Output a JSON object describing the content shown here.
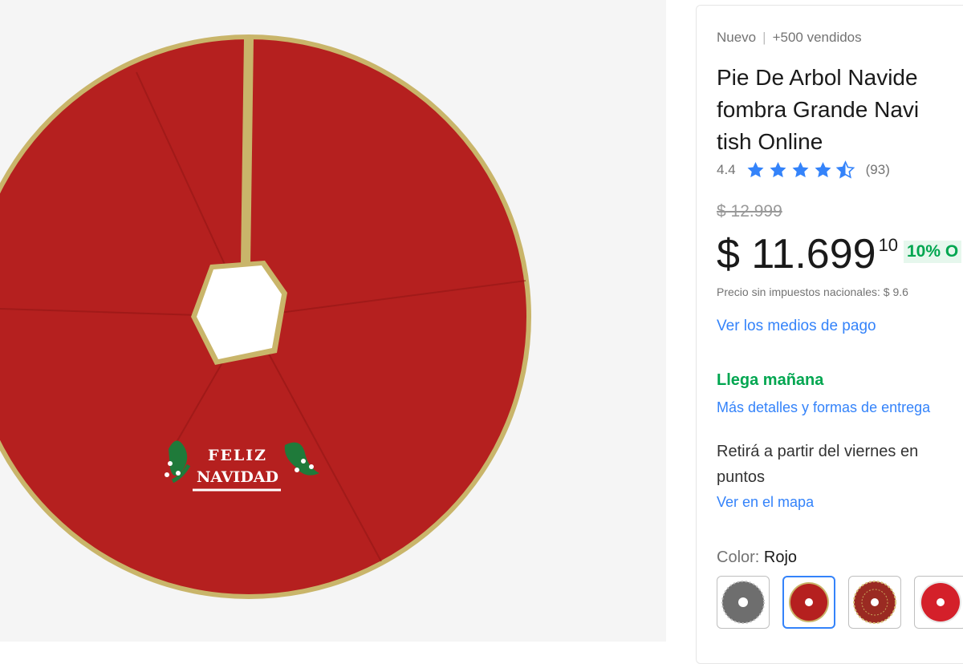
{
  "product": {
    "condition": "Nuevo",
    "separator": "|",
    "sold": "+500 vendidos",
    "title_lines": [
      "Pie De Arbol Navide",
      "fombra Grande Navi",
      "tish Online"
    ],
    "rating_value": "4.4",
    "rating_stars": 4.5,
    "review_count": "(93)"
  },
  "pricing": {
    "original_price": "$ 12.999",
    "price": "$ 11.699",
    "price_cents": "10",
    "discount": "10% O",
    "tax_note": "Precio sin impuestos nacionales: $ 9.6"
  },
  "links": {
    "payment_methods": "Ver los medios de pago",
    "delivery_details": "Más detalles y formas de entrega",
    "view_map": "Ver en el mapa"
  },
  "shipping": {
    "arrival": "Llega mañana",
    "pickup_lines": [
      "Retirá a partir del viernes en",
      "puntos"
    ]
  },
  "variants": {
    "label": "Color: ",
    "selected": "Rojo",
    "options": [
      "gray",
      "red",
      "red-pattern",
      "red-bright"
    ]
  },
  "image_text": {
    "line1": "FELIZ",
    "line2": "NAVIDAD"
  },
  "colors": {
    "accent": "#3483fa",
    "success": "#00a650",
    "skirt_red": "#b5201f",
    "trim_gold": "#c9b56a"
  }
}
